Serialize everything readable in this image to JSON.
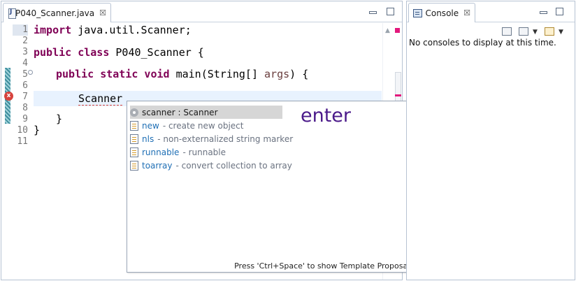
{
  "editor": {
    "tab_title": "*P040_Scanner.java",
    "tab_close": "☒",
    "line_numbers": [
      "1",
      "2",
      "3",
      "4",
      "5",
      "6",
      "7",
      "8",
      "9",
      "10",
      "11"
    ],
    "code": {
      "l1_kw": "import",
      "l1_rest": " java.util.Scanner;",
      "l3_kw": "public class",
      "l3_rest": " P040_Scanner {",
      "l5_kw": "public static void",
      "l5_rest": " main(String[] ",
      "l5_param": "args",
      "l5_end": ") {",
      "l7_text": "Scanner",
      "l9_text": "}",
      "l10_text": "}"
    },
    "error_badge": "x"
  },
  "content_assist": {
    "proposals": [
      {
        "name": "scanner : Scanner",
        "desc": "",
        "icon": "local-variable-icon",
        "selected": true
      },
      {
        "name": "new",
        "desc": " - create new object",
        "icon": "template-icon",
        "selected": false
      },
      {
        "name": "nls",
        "desc": " - non-externalized string marker",
        "icon": "template-icon",
        "selected": false
      },
      {
        "name": "runnable",
        "desc": " - runnable",
        "icon": "template-icon",
        "selected": false
      },
      {
        "name": "toarray",
        "desc": " - convert collection to array",
        "icon": "template-icon",
        "selected": false
      }
    ],
    "overlay_text": "enter",
    "footer": "Press 'Ctrl+Space' to show Template Proposals"
  },
  "console": {
    "tab_title": "Console",
    "tab_close": "☒",
    "message": "No consoles to display at this time."
  },
  "colors": {
    "keyword": "#7f0055",
    "error": "#d6433d",
    "current_line": "#e8f2fe",
    "overlay_text": "#4b1a8a"
  }
}
